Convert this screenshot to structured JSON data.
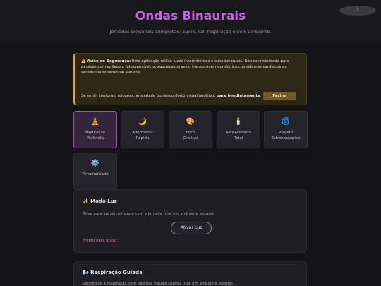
{
  "header": {
    "title": "Ondas Binaurais",
    "subtitle": "Jornadas sensoriais completas: áudio, luz, respiração e som ambiente.",
    "help_label": "?"
  },
  "warning": {
    "icon": "⚠️",
    "heading": "Aviso de Segurança:",
    "body": "Esta aplicação utiliza luzes intermitentes e sons binaurais. Não recomendada para pessoas com epilepsia fotossensível, enxaquecas graves, transtornos neurológicos, problemas cardíacos ou sensibilidade sensorial elevada.",
    "footer_text": "Se sentir tonturas, náuseas, ansiedade ou desconforto visual/auditivo,",
    "footer_bold": "pare imediatamente",
    "close_label": "Fechar"
  },
  "modes": [
    {
      "icon": "🧘",
      "label": "Meditação\nProfunda",
      "active": true
    },
    {
      "icon": "🌙",
      "label": "Adormecer\nRápido",
      "active": false
    },
    {
      "icon": "🎨",
      "label": "Foco\nCriativo",
      "active": false
    },
    {
      "icon": "🕯️",
      "label": "Relaxamento\nTotal",
      "active": false
    },
    {
      "icon": "🌀",
      "label": "Viagem\nEstroboscópica",
      "active": false
    },
    {
      "icon": "⚙️",
      "label": "Personalizado",
      "active": false
    }
  ],
  "light_mode": {
    "icon": "✨",
    "title": "Modo Luz",
    "description": "Ative para luz sincronizada com a jornada (use em ambiente escuro).",
    "button_label": "Ativar Luz",
    "status": "Pronto para ativar."
  },
  "breathing": {
    "icon": "🌬️",
    "title": "Respiração Guiada",
    "description": "Sincronize a respiração com padrões visuais suaves (use em ambiente escuro)."
  },
  "colors": {
    "accent": "#c85fe0",
    "warning_border": "#d9a73a",
    "status": "#e06aa8"
  }
}
